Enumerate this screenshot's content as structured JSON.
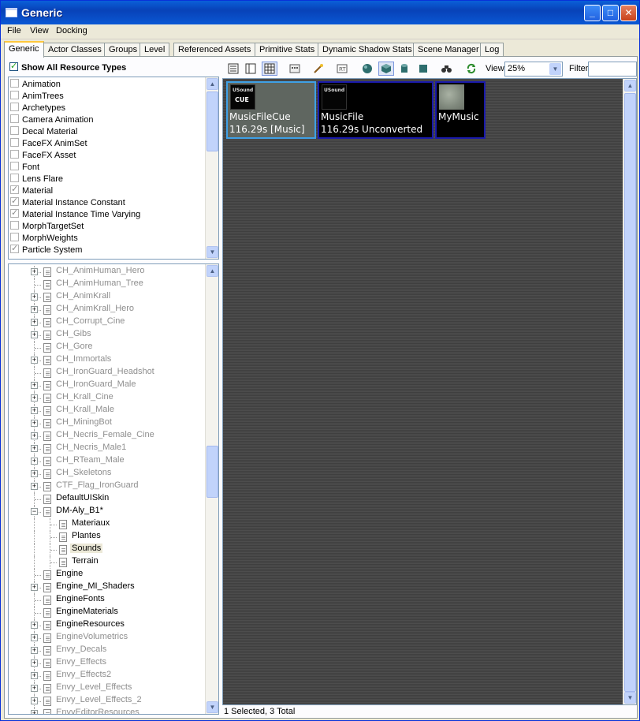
{
  "window": {
    "title": "Generic"
  },
  "menu": [
    "File",
    "View",
    "Docking"
  ],
  "tabs": [
    "Generic",
    "Actor Classes",
    "Groups",
    "Level",
    "Referenced Assets",
    "Primitive Stats",
    "Dynamic Shadow Stats",
    "Scene Manager",
    "Log"
  ],
  "active_tab": "Generic",
  "resource_filter": {
    "show_all_label": "Show All Resource Types",
    "show_all_checked": true,
    "types": [
      {
        "label": "Animation",
        "checked": false
      },
      {
        "label": "AnimTrees",
        "checked": false
      },
      {
        "label": "Archetypes",
        "checked": false
      },
      {
        "label": "Camera Animation",
        "checked": false
      },
      {
        "label": "Decal Material",
        "checked": false
      },
      {
        "label": "FaceFX AnimSet",
        "checked": false
      },
      {
        "label": "FaceFX Asset",
        "checked": false
      },
      {
        "label": "Font",
        "checked": false
      },
      {
        "label": "Lens Flare",
        "checked": false
      },
      {
        "label": "Material",
        "checked": true
      },
      {
        "label": "Material Instance Constant",
        "checked": true
      },
      {
        "label": "Material Instance Time Varying",
        "checked": true
      },
      {
        "label": "MorphTargetSet",
        "checked": false
      },
      {
        "label": "MorphWeights",
        "checked": false
      },
      {
        "label": "Particle System",
        "checked": true
      }
    ]
  },
  "package_tree": [
    {
      "label": "CH_AnimHuman_Hero",
      "level": 0,
      "expandable": true,
      "dim": true
    },
    {
      "label": "CH_AnimHuman_Tree",
      "level": 0,
      "expandable": false,
      "dim": true
    },
    {
      "label": "CH_AnimKrall",
      "level": 0,
      "expandable": true,
      "dim": true
    },
    {
      "label": "CH_AnimKrall_Hero",
      "level": 0,
      "expandable": true,
      "dim": true
    },
    {
      "label": "CH_Corrupt_Cine",
      "level": 0,
      "expandable": true,
      "dim": true
    },
    {
      "label": "CH_Gibs",
      "level": 0,
      "expandable": true,
      "dim": true
    },
    {
      "label": "CH_Gore",
      "level": 0,
      "expandable": false,
      "dim": true
    },
    {
      "label": "CH_Immortals",
      "level": 0,
      "expandable": true,
      "dim": true
    },
    {
      "label": "CH_IronGuard_Headshot",
      "level": 0,
      "expandable": false,
      "dim": true
    },
    {
      "label": "CH_IronGuard_Male",
      "level": 0,
      "expandable": true,
      "dim": true
    },
    {
      "label": "CH_Krall_Cine",
      "level": 0,
      "expandable": true,
      "dim": true
    },
    {
      "label": "CH_Krall_Male",
      "level": 0,
      "expandable": true,
      "dim": true
    },
    {
      "label": "CH_MiningBot",
      "level": 0,
      "expandable": true,
      "dim": true
    },
    {
      "label": "CH_Necris_Female_Cine",
      "level": 0,
      "expandable": true,
      "dim": true
    },
    {
      "label": "CH_Necris_Male1",
      "level": 0,
      "expandable": true,
      "dim": true
    },
    {
      "label": "CH_RTeam_Male",
      "level": 0,
      "expandable": true,
      "dim": true
    },
    {
      "label": "CH_Skeletons",
      "level": 0,
      "expandable": true,
      "dim": true
    },
    {
      "label": "CTF_Flag_IronGuard",
      "level": 0,
      "expandable": true,
      "dim": true
    },
    {
      "label": "DefaultUISkin",
      "level": 0,
      "expandable": false,
      "dim": false
    },
    {
      "label": "DM-Aly_B1*",
      "level": 0,
      "expandable": true,
      "expanded": true,
      "dim": false
    },
    {
      "label": "Materiaux",
      "level": 1,
      "expandable": false,
      "dim": false
    },
    {
      "label": "Plantes",
      "level": 1,
      "expandable": false,
      "dim": false
    },
    {
      "label": "Sounds",
      "level": 1,
      "expandable": false,
      "dim": false,
      "selected": true
    },
    {
      "label": "Terrain",
      "level": 1,
      "expandable": false,
      "dim": false
    },
    {
      "label": "Engine",
      "level": 0,
      "expandable": false,
      "dim": false
    },
    {
      "label": "Engine_MI_Shaders",
      "level": 0,
      "expandable": true,
      "dim": false
    },
    {
      "label": "EngineFonts",
      "level": 0,
      "expandable": false,
      "dim": false
    },
    {
      "label": "EngineMaterials",
      "level": 0,
      "expandable": false,
      "dim": false
    },
    {
      "label": "EngineResources",
      "level": 0,
      "expandable": true,
      "dim": false
    },
    {
      "label": "EngineVolumetrics",
      "level": 0,
      "expandable": true,
      "dim": true
    },
    {
      "label": "Envy_Decals",
      "level": 0,
      "expandable": true,
      "dim": true
    },
    {
      "label": "Envy_Effects",
      "level": 0,
      "expandable": true,
      "dim": true
    },
    {
      "label": "Envy_Effects2",
      "level": 0,
      "expandable": true,
      "dim": true
    },
    {
      "label": "Envy_Level_Effects",
      "level": 0,
      "expandable": true,
      "dim": true
    },
    {
      "label": "Envy_Level_Effects_2",
      "level": 0,
      "expandable": true,
      "dim": true
    },
    {
      "label": "EnvyEditorResources",
      "level": 0,
      "expandable": true,
      "dim": true
    }
  ],
  "toolbar": {
    "view_label": "View",
    "view_value": "25%",
    "filter_label": "Filter",
    "filter_value": ""
  },
  "assets": [
    {
      "name": "MusicFileCue",
      "detail": "116.29s [Music]",
      "thumb_text": [
        "USound",
        "CUE"
      ],
      "selected": true
    },
    {
      "name": "MusicFile",
      "detail": "116.29s Unconverted",
      "thumb_text": [
        "USound",
        ""
      ],
      "selected": false
    },
    {
      "name": "MyMusic",
      "detail": "",
      "thumb_text": [
        "",
        ""
      ],
      "selected": false
    }
  ],
  "status": "1 Selected, 3 Total",
  "colors": {
    "selection_border": "#3ea0e6",
    "asset_border": "#1a1aaa",
    "titlebar": "#0842b8"
  }
}
